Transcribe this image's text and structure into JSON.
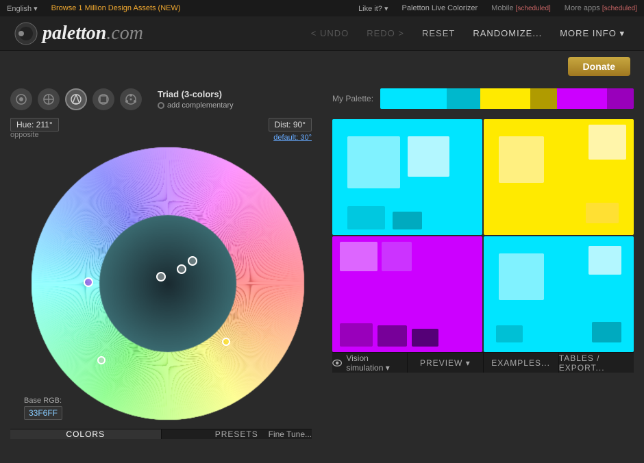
{
  "topbar": {
    "lang": "English ▾",
    "browse": "Browse 1 Million Design Assets (NEW)",
    "like": "Like it? ▾",
    "live_colorizer": "Paletton Live Colorizer",
    "mobile": "Mobile",
    "scheduled1": "[scheduled]",
    "more_apps": "More apps",
    "scheduled2": "[scheduled]"
  },
  "header": {
    "logo_text": "paletton",
    "logo_domain": ".com",
    "undo": "< UNDO",
    "redo": "REDO >",
    "reset": "RESET",
    "randomize": "RANDOMIZE...",
    "more_info": "MORE INFO ▾"
  },
  "donate": {
    "label": "Donate"
  },
  "left": {
    "hue": "Hue: 211°",
    "opposite": "opposite",
    "dist": "Dist: 90°",
    "default_link": "default: 30°",
    "mode_label": "Triad (3-colors)",
    "add_complementary": "add complementary",
    "base_rgb_label": "Base RGB:",
    "base_rgb_value": "33F6FF",
    "fine_tune": "Fine Tune..."
  },
  "right": {
    "palette_label": "My Palette:",
    "palette_colors": [
      "#00e5ff",
      "#00b8cc",
      "#ffea00",
      "#b09b00",
      "#cc00ff",
      "#9900bb"
    ],
    "grid": {
      "q1_main": "#00e5ff",
      "q1_light": "#80f2ff",
      "q1_lighter": "#b3f7ff",
      "q2_main": "#ffea00",
      "q2_light": "#fff080",
      "q2_lighter": "#fff5b3",
      "q3_main": "#cc00ff",
      "q3_light1": "#dd66ff",
      "q3_light2": "#cc33ff",
      "q3_dark": "#9900bb",
      "q3_darker": "#770099",
      "q4_main": "#00e5ff",
      "q4_light": "#80f2ff",
      "q4_lighter": "#b3f7ff"
    }
  },
  "bottom": {
    "colors_label": "COLORS",
    "presets_label": "PRESETS",
    "preview_label": "PREVIEW ▾",
    "vision_label": "Vision simulation ▾",
    "examples_label": "EXAMPLES...",
    "tables_label": "TABLES / EXPORT..."
  },
  "icons": {
    "eye_icon": "👁",
    "mode1": "◉",
    "mode2": "⊕",
    "mode3": "✦",
    "mode4": "✚",
    "mode5": "⚙"
  }
}
